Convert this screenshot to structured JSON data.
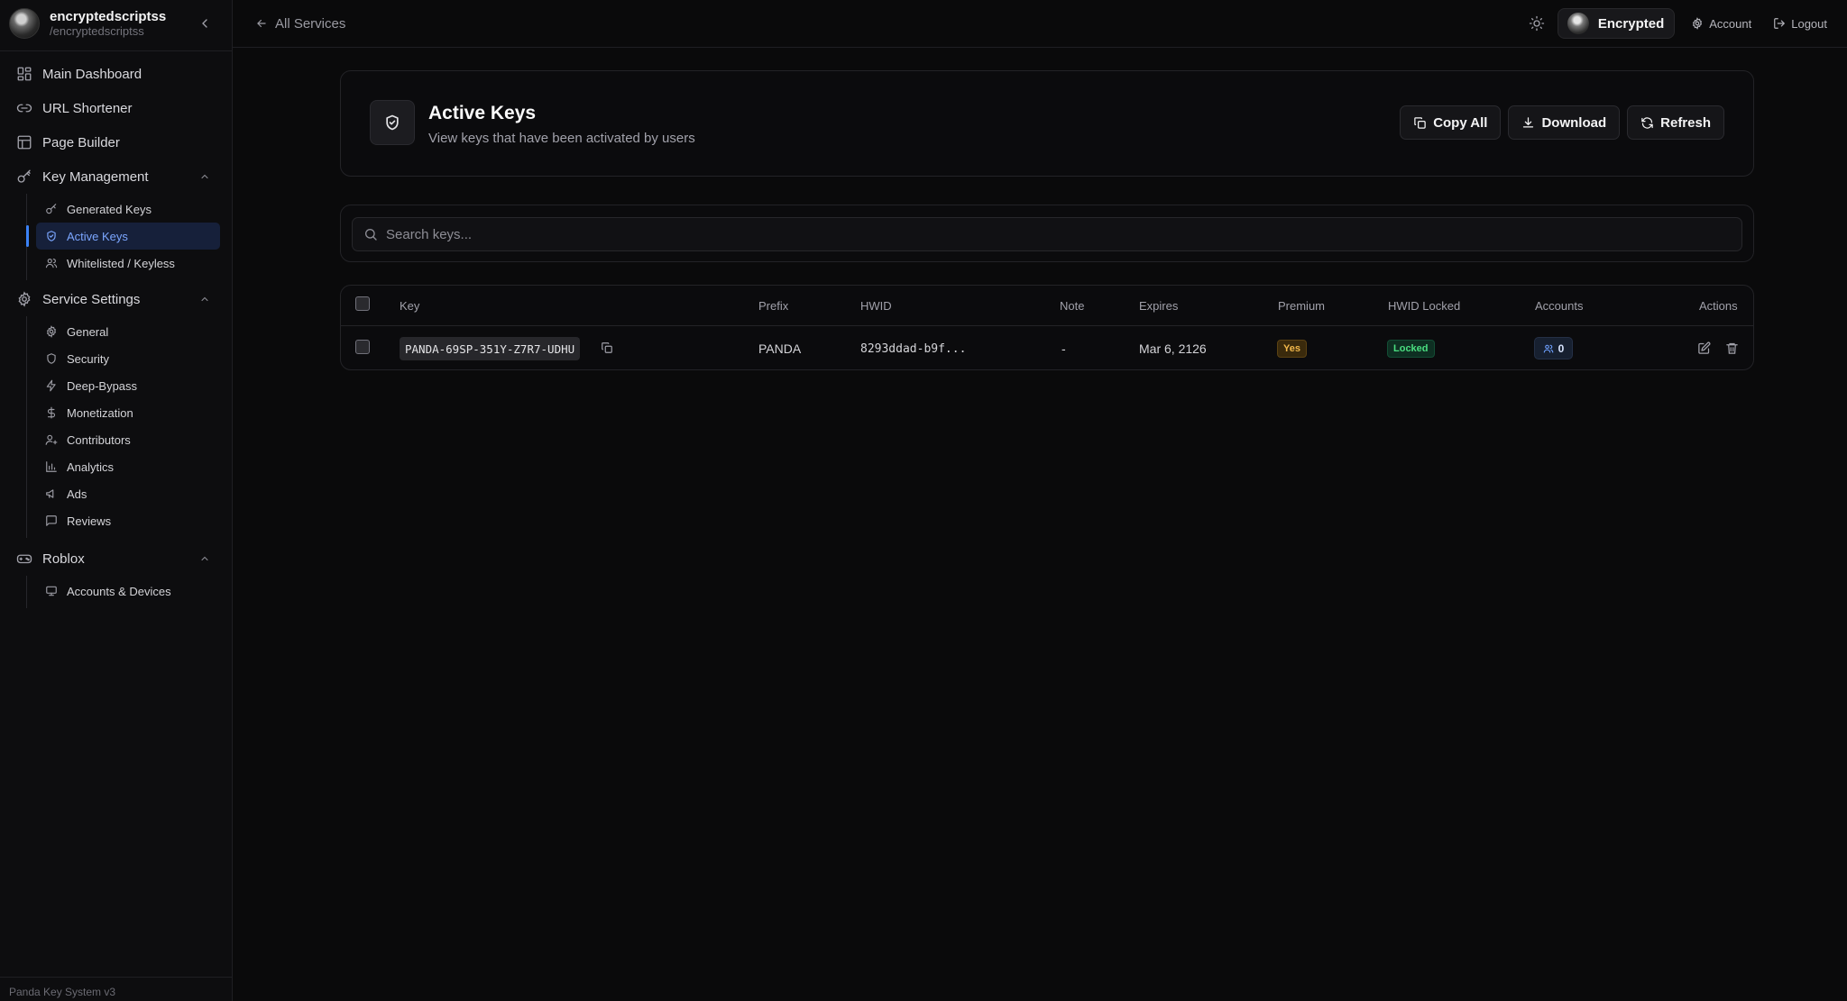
{
  "sidebar": {
    "user": {
      "name": "encryptedscriptss",
      "handle": "/encryptedscriptss"
    },
    "main_items": [
      {
        "label": "Main Dashboard",
        "icon": "dashboard-icon"
      },
      {
        "label": "URL Shortener",
        "icon": "link-icon"
      },
      {
        "label": "Page Builder",
        "icon": "layout-icon"
      }
    ],
    "key_management": {
      "label": "Key Management",
      "items": [
        {
          "label": "Generated Keys",
          "icon": "key-icon"
        },
        {
          "label": "Active Keys",
          "icon": "shield-check-icon"
        },
        {
          "label": "Whitelisted / Keyless",
          "icon": "users-icon"
        }
      ]
    },
    "service_settings": {
      "label": "Service Settings",
      "items": [
        {
          "label": "General",
          "icon": "gear-icon"
        },
        {
          "label": "Security",
          "icon": "shield-icon"
        },
        {
          "label": "Deep-Bypass",
          "icon": "zap-icon"
        },
        {
          "label": "Monetization",
          "icon": "dollar-icon"
        },
        {
          "label": "Contributors",
          "icon": "user-plus-icon"
        },
        {
          "label": "Analytics",
          "icon": "bar-chart-icon"
        },
        {
          "label": "Ads",
          "icon": "megaphone-icon"
        },
        {
          "label": "Reviews",
          "icon": "message-square-icon"
        }
      ]
    },
    "roblox": {
      "label": "Roblox",
      "items": [
        {
          "label": "Accounts & Devices",
          "icon": "monitor-icon"
        }
      ]
    },
    "footer": "Panda Key System v3"
  },
  "topbar": {
    "back_label": "All Services",
    "profile_name": "Encrypted",
    "account_label": "Account",
    "logout_label": "Logout"
  },
  "header": {
    "title": "Active Keys",
    "subtitle": "View keys that have been activated by users",
    "buttons": {
      "copy_all": "Copy All",
      "download": "Download",
      "refresh": "Refresh"
    }
  },
  "search": {
    "placeholder": "Search keys...",
    "value": ""
  },
  "table": {
    "columns": [
      "Key",
      "Prefix",
      "HWID",
      "Note",
      "Expires",
      "Premium",
      "HWID Locked",
      "Accounts",
      "Actions"
    ],
    "rows": [
      {
        "key": "PANDA-69SP-351Y-Z7R7-UDHU",
        "prefix": "PANDA",
        "hwid": "8293ddad-b9f...",
        "note": "-",
        "expires": "Mar 6, 2126",
        "premium": "Yes",
        "hwid_locked": "Locked",
        "accounts": "0"
      }
    ]
  },
  "colors": {
    "accent": "#3b82f6",
    "background": "#0a0a0b",
    "success": "#4ade80",
    "warning": "#f2b84b"
  }
}
